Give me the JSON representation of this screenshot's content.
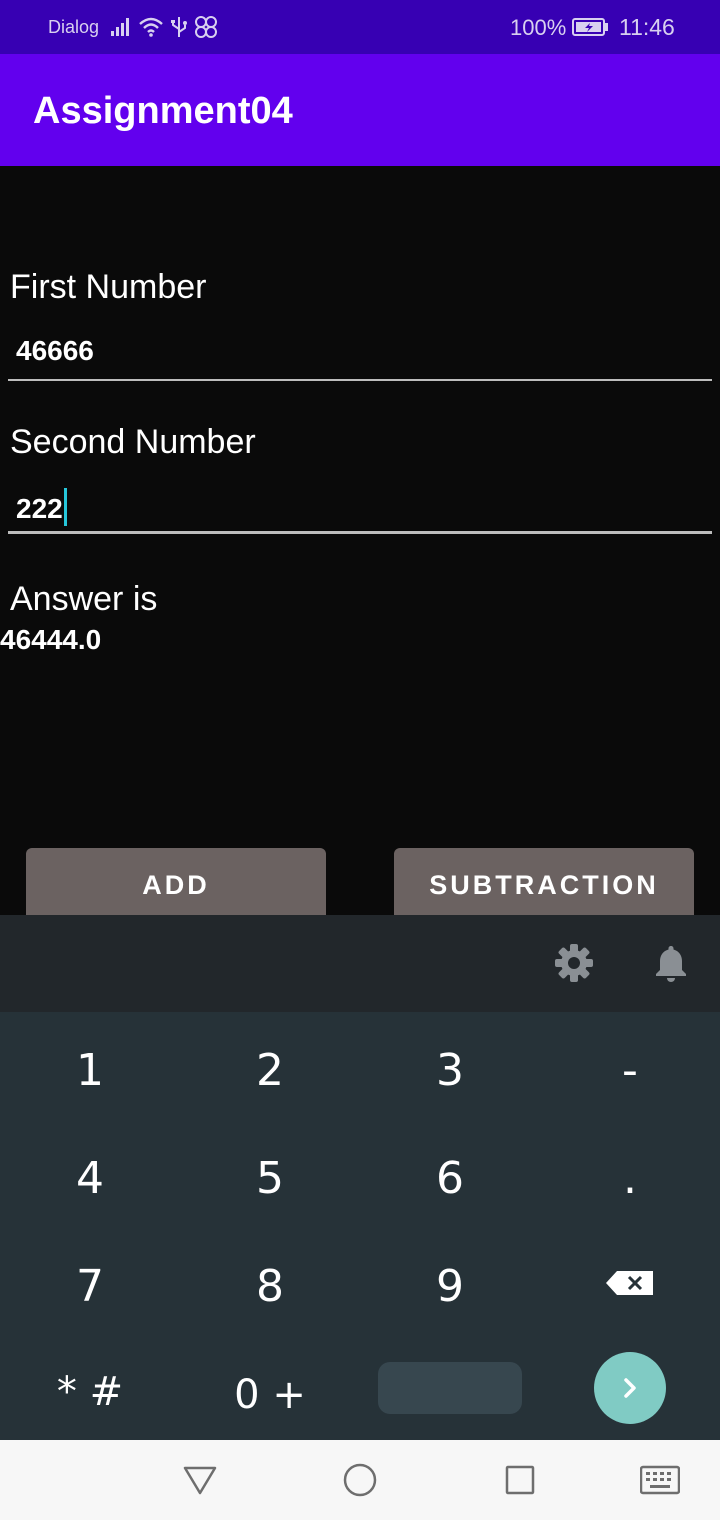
{
  "status_bar": {
    "carrier": "Dialog",
    "battery_percent": "100%",
    "time": "11:46",
    "icons": [
      "signal-icon",
      "wifi-icon",
      "usb-icon",
      "link-icon",
      "battery-charging-icon"
    ]
  },
  "app_bar": {
    "title": "Assignment04"
  },
  "form": {
    "first_label": "First Number",
    "first_value": "46666",
    "second_label": "Second Number",
    "second_value": "222",
    "answer_label": "Answer is",
    "answer_value": "46444.0"
  },
  "buttons": {
    "add": "ADD",
    "subtraction": "SUBTRACTION"
  },
  "keyboard": {
    "toolbar_icons": [
      "gear-icon",
      "bell-icon"
    ],
    "rows": [
      [
        "1",
        "2",
        "3",
        "-"
      ],
      [
        "4",
        "5",
        "6",
        "."
      ],
      [
        "7",
        "8",
        "9",
        "⌫"
      ],
      [
        "* #",
        "0 +",
        "",
        "›"
      ]
    ]
  },
  "nav_bar": {
    "icons": [
      "back-icon",
      "home-icon",
      "recents-icon",
      "keyboard-icon"
    ]
  },
  "colors": {
    "status_bar": "#3700b3",
    "app_bar": "#6200ee",
    "background": "#0a0a0a",
    "button": "#6b6261",
    "keyboard": "#263238",
    "go_key": "#80cbc4",
    "cursor": "#26c6da"
  }
}
